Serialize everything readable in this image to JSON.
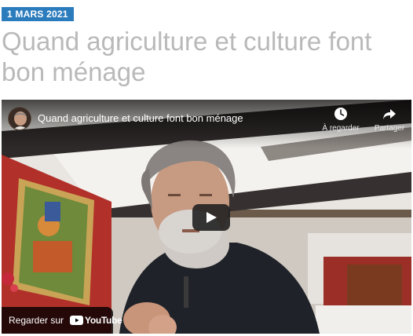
{
  "article": {
    "date": "1 MARS 2021",
    "title": "Quand agriculture et culture font bon ménage"
  },
  "video": {
    "title": "Quand agriculture et culture font bon ménage",
    "actions": {
      "watch_later": {
        "label": "À regarder",
        "icon": "clock-icon"
      },
      "share": {
        "label": "Partager",
        "icon": "share-arrow-icon"
      }
    },
    "watch_on_label": "Regarder sur",
    "youtube_logo": "YouTube",
    "play_icon": "play-icon"
  },
  "colors": {
    "badge": "#2b7cbd",
    "title": "#b9b9b9",
    "youtube_red": "#ff0000"
  }
}
